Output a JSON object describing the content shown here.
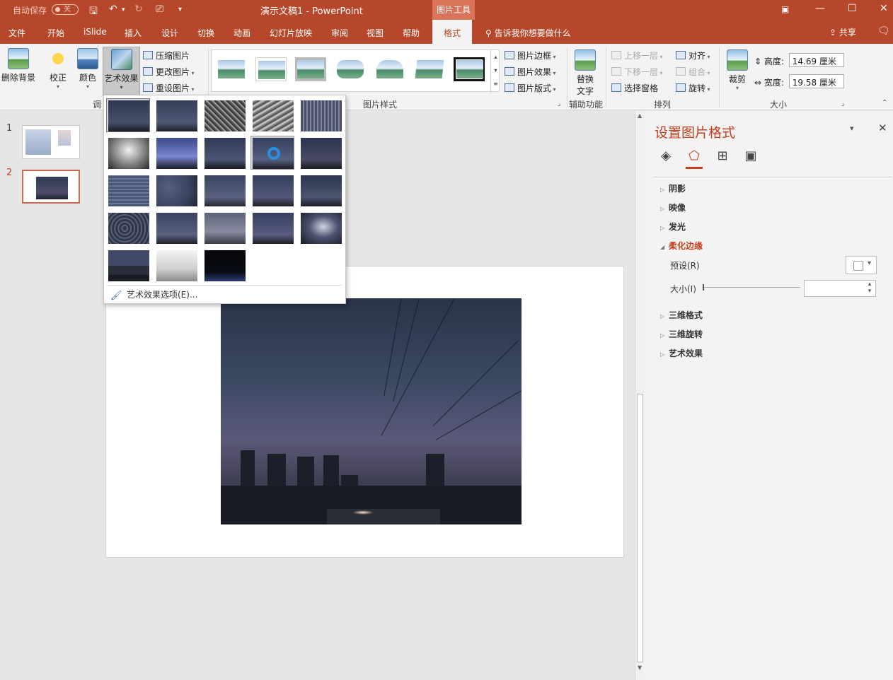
{
  "titlebar": {
    "autosave_label": "自动保存",
    "autosave_state": "关",
    "document_title": "演示文稿1  -  PowerPoint",
    "context_tab_group": "图片工具"
  },
  "tabs": [
    "文件",
    "开始",
    "iSlide",
    "插入",
    "设计",
    "切换",
    "动画",
    "幻灯片放映",
    "审阅",
    "视图",
    "帮助",
    "格式"
  ],
  "active_tab": "格式",
  "tell_me": "告诉我你想要做什么",
  "share": "共享",
  "ribbon": {
    "adjust": {
      "remove_background": "删除背景",
      "corrections": "校正",
      "color": "颜色",
      "artistic_effects": "艺术效果",
      "compress": "压缩图片",
      "change": "更改图片",
      "reset": "重设图片",
      "group_label": "调"
    },
    "picture_styles": {
      "group_label": "图片样式",
      "border": "图片边框",
      "effects": "图片效果",
      "layout": "图片版式"
    },
    "accessibility": {
      "alt_text_line1": "替换",
      "alt_text_line2": "文字",
      "group_label": "辅助功能"
    },
    "arrange": {
      "bring_forward": "上移一层",
      "send_backward": "下移一层",
      "selection_pane": "选择窗格",
      "align": "对齐",
      "group": "组合",
      "rotate": "旋转",
      "group_label": "排列"
    },
    "size": {
      "crop": "裁剪",
      "height_label": "高度:",
      "height_value": "14.69 厘米",
      "width_label": "宽度:",
      "width_value": "19.58 厘米",
      "group_label": "大小"
    }
  },
  "slides": [
    {
      "number": "1"
    },
    {
      "number": "2"
    }
  ],
  "artistic_dropdown": {
    "options_label": "艺术效果选项(E)..."
  },
  "format_pane": {
    "title": "设置图片格式",
    "sections": {
      "shadow": "阴影",
      "reflection": "映像",
      "glow": "发光",
      "soft_edges": "柔化边缘",
      "preset": "预设(R)",
      "size": "大小(I)",
      "format_3d": "三维格式",
      "rotation_3d": "三维旋转",
      "artistic": "艺术效果"
    }
  },
  "colors": {
    "accent": "#b7472a",
    "pane_title": "#c43e1c"
  }
}
